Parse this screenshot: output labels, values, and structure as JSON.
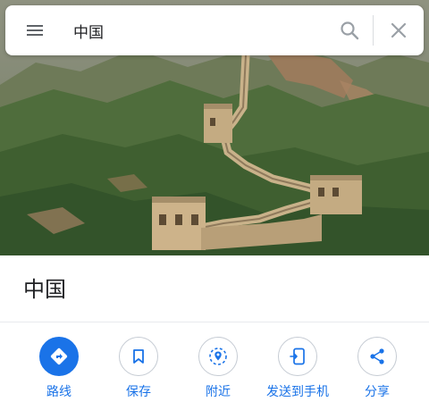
{
  "search": {
    "query": "中国"
  },
  "place": {
    "name": "中国"
  },
  "actions": [
    {
      "id": "directions",
      "label": "路线",
      "icon": "directions-icon"
    },
    {
      "id": "save",
      "label": "保存",
      "icon": "bookmark-icon"
    },
    {
      "id": "nearby",
      "label": "附近",
      "icon": "nearby-pin-icon"
    },
    {
      "id": "send-to-phone",
      "label": "发送到手机",
      "icon": "send-to-phone-icon"
    },
    {
      "id": "share",
      "label": "分享",
      "icon": "share-icon"
    }
  ],
  "colors": {
    "accent": "#1a73e8",
    "icon_gray": "#5f6368",
    "text": "#202124"
  }
}
